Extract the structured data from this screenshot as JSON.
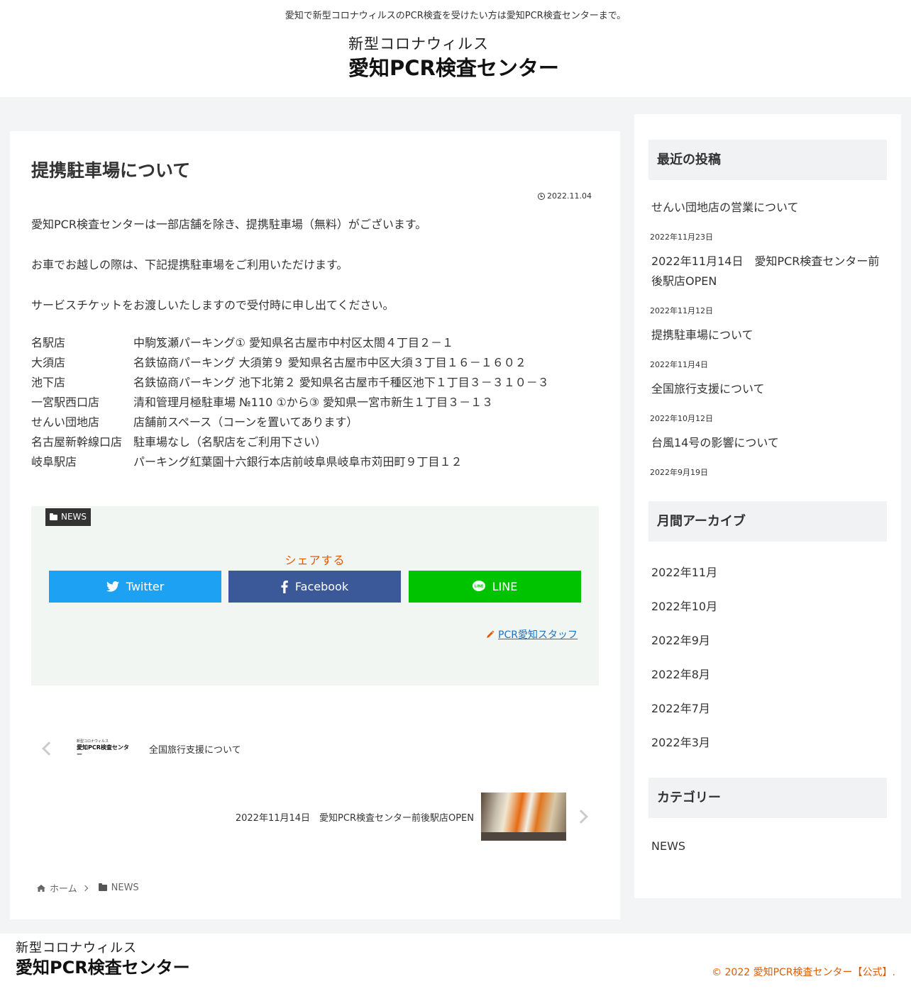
{
  "header": {
    "tagline": "愛知で新型コロナウィルスのPCR検査を受けたい方は愛知PCR検査センターまで。",
    "logo_line1": "新型コロナウィルス",
    "logo_line2": "愛知PCR検査センター"
  },
  "article": {
    "title": "提携駐車場について",
    "date": "2022.11.04",
    "paragraphs": [
      "愛知PCR検査センターは一部店舗を除き、提携駐車場（無料）がございます。",
      "お車でお越しの際は、下記提携駐車場をご利用いただけます。",
      "サービスチケットをお渡しいたしますので受付時に申し出てください。"
    ],
    "stores": [
      {
        "name": "名駅店",
        "detail": "中駒笈瀬パーキング① 愛知県名古屋市中村区太閤４丁目２－１"
      },
      {
        "name": "大須店",
        "detail": "名鉄協商パーキング 大須第９ 愛知県名古屋市中区大須３丁目１６－１６０２"
      },
      {
        "name": "池下店",
        "detail": "名鉄協商パーキング 池下北第２ 愛知県名古屋市千種区池下１丁目３－３１０－３"
      },
      {
        "name": "一宮駅西口店",
        "detail": "清和管理月極駐車場 №110 ①から③ 愛知県一宮市新生１丁目３－１３"
      },
      {
        "name": "せんい団地店",
        "detail": "店舗前スペース（コーンを置いてあります）"
      },
      {
        "name": "名古屋新幹線口店",
        "detail": "駐車場なし（名駅店をご利用下さい）"
      },
      {
        "name": "岐阜駅店",
        "detail": "パーキング紅葉園十六銀行本店前岐阜県岐阜市苅田町９丁目１２"
      }
    ],
    "category": "NEWS",
    "share_label": "シェアする",
    "share": {
      "twitter": "Twitter",
      "facebook": "Facebook",
      "line": "LINE"
    },
    "author": "PCR愛知スタッフ"
  },
  "post_nav": {
    "prev_logo_line1": "新型コロナウィルス",
    "prev_logo_line2": "愛知PCR検査センター",
    "prev_title": "全国旅行支援について",
    "next_title": "2022年11月14日　愛知PCR検査センター前後駅店OPEN"
  },
  "breadcrumb": {
    "home": "ホーム",
    "category": "NEWS"
  },
  "sidebar": {
    "recent_heading": "最近の投稿",
    "recent_posts": [
      {
        "title": "せんい団地店の営業について",
        "date": "2022年11月23日"
      },
      {
        "title": "2022年11月14日　愛知PCR検査センター前後駅店OPEN",
        "date": "2022年11月12日"
      },
      {
        "title": "提携駐車場について",
        "date": "2022年11月4日"
      },
      {
        "title": "全国旅行支援について",
        "date": "2022年10月12日"
      },
      {
        "title": "台風14号の影響について",
        "date": "2022年9月19日"
      }
    ],
    "archive_heading": "月間アーカイブ",
    "archives": [
      "2022年11月",
      "2022年10月",
      "2022年9月",
      "2022年8月",
      "2022年7月",
      "2022年3月"
    ],
    "category_heading": "カテゴリー",
    "categories": [
      "NEWS"
    ]
  },
  "footer": {
    "logo_line1": "新型コロナウィルス",
    "logo_line2": "愛知PCR検査センター",
    "copyright": "© 2022 愛知PCR検査センター【公式】."
  },
  "colors": {
    "accent": "#e05a00",
    "twitter": "#1da1f2",
    "facebook": "#3b5998",
    "line": "#00c300"
  }
}
